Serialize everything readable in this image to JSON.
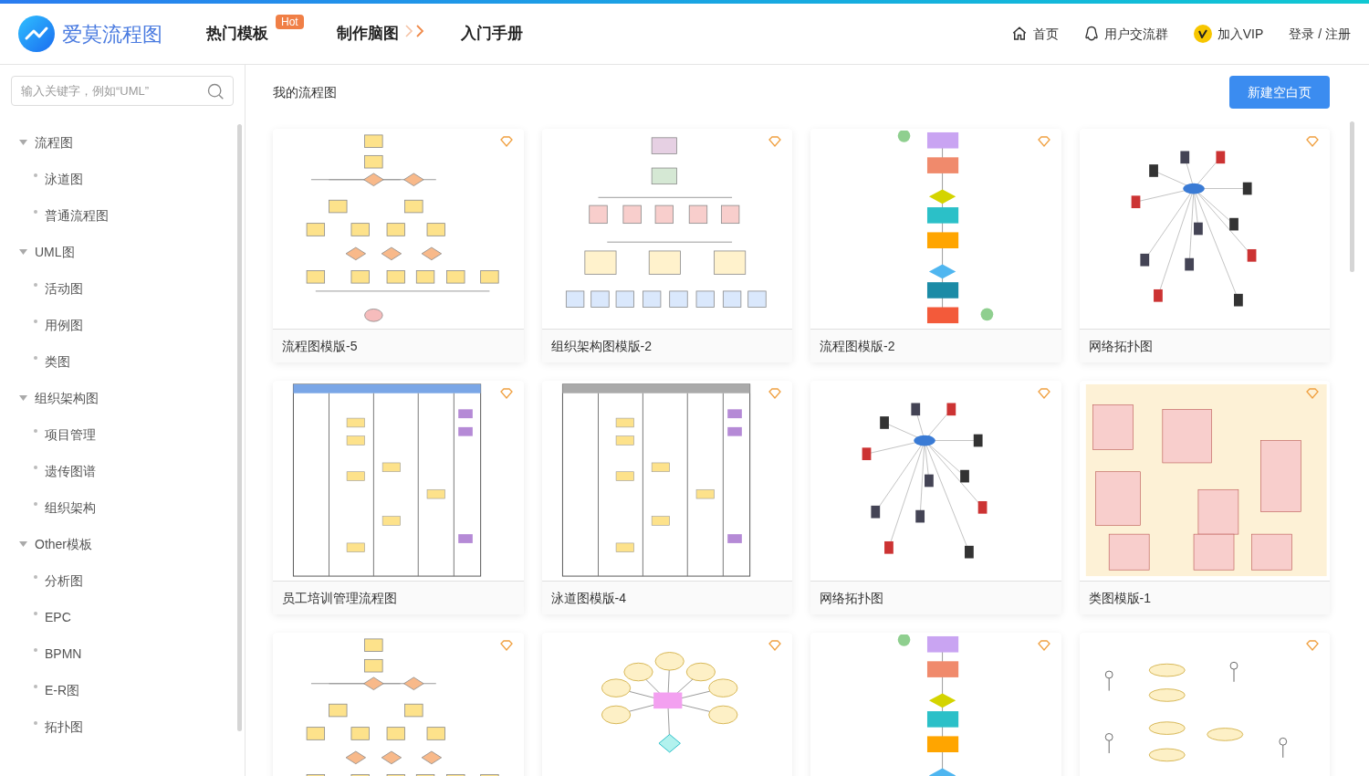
{
  "header": {
    "logo": "爱莫流程图",
    "nav": [
      {
        "label": "热门模板",
        "badge": "Hot",
        "kind": "badge"
      },
      {
        "label": "制作脑图",
        "kind": "chevrons"
      },
      {
        "label": "入门手册",
        "kind": "plain"
      }
    ],
    "links": [
      {
        "label": "首页",
        "kind": "home"
      },
      {
        "label": "用户交流群",
        "kind": "chat"
      },
      {
        "label": "加入VIP",
        "kind": "vip"
      },
      {
        "label": "登录 / 注册",
        "kind": "plain"
      }
    ]
  },
  "sidebar": {
    "search": {
      "placeholder": "输入关键字，例如“UML”"
    },
    "tree": [
      {
        "label": "流程图",
        "expanded": true,
        "children": [
          {
            "label": "泳道图"
          },
          {
            "label": "普通流程图"
          }
        ]
      },
      {
        "label": "UML图",
        "expanded": true,
        "children": [
          {
            "label": "活动图"
          },
          {
            "label": "用例图"
          },
          {
            "label": "类图"
          }
        ]
      },
      {
        "label": "组织架构图",
        "expanded": true,
        "children": [
          {
            "label": "项目管理"
          },
          {
            "label": "遗传图谱"
          },
          {
            "label": "组织架构"
          }
        ]
      },
      {
        "label": "Other模板",
        "expanded": true,
        "children": [
          {
            "label": "分析图"
          },
          {
            "label": "EPC"
          },
          {
            "label": "BPMN"
          },
          {
            "label": "E-R图"
          },
          {
            "label": "拓扑图"
          }
        ]
      }
    ]
  },
  "main": {
    "title": "我的流程图",
    "new_button": "新建空白页",
    "cards": [
      {
        "title": "流程图模版-5",
        "kind": "flow"
      },
      {
        "title": "组织架构图模版-2",
        "kind": "org"
      },
      {
        "title": "流程图模版-2",
        "kind": "vflow"
      },
      {
        "title": "网络拓扑图",
        "kind": "network"
      },
      {
        "title": "员工培训管理流程图",
        "kind": "swimlane"
      },
      {
        "title": "泳道图模版-4",
        "kind": "swimlane2"
      },
      {
        "title": "网络拓扑图",
        "kind": "network"
      },
      {
        "title": "类图模版-1",
        "kind": "class"
      },
      {
        "kind": "flow"
      },
      {
        "kind": "mind"
      },
      {
        "kind": "vflow"
      },
      {
        "kind": "usecase"
      }
    ]
  }
}
